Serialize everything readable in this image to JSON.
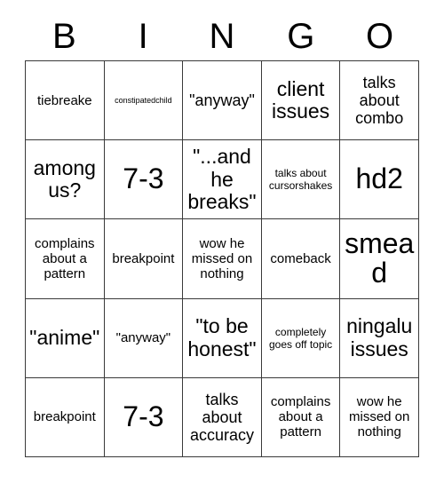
{
  "card": {
    "title": "BINGO",
    "header_letters": [
      "B",
      "I",
      "N",
      "G",
      "O"
    ],
    "columns": 5,
    "rows": 5,
    "colors": {
      "background": "#ffffff",
      "text": "#000000",
      "grid_line": "#3a3a3a"
    },
    "cells": [
      {
        "text": "tiebreake",
        "size": "fs-md"
      },
      {
        "text": "constipatedchild",
        "size": "fs-xs"
      },
      {
        "text": "\"anyway\"",
        "size": "fs-lg"
      },
      {
        "text": "client issues",
        "size": "fs-xl"
      },
      {
        "text": "talks about combo",
        "size": "fs-lg"
      },
      {
        "text": "among us?",
        "size": "fs-xl"
      },
      {
        "text": "7-3",
        "size": "fs-xxl"
      },
      {
        "text": "\"...and he breaks\"",
        "size": "fs-xl"
      },
      {
        "text": "talks about cursorshakes",
        "size": "fs-sm"
      },
      {
        "text": "hd2",
        "size": "fs-xxl"
      },
      {
        "text": "complains about a pattern",
        "size": "fs-md"
      },
      {
        "text": "breakpoint",
        "size": "fs-md"
      },
      {
        "text": "wow he missed on nothing",
        "size": "fs-md"
      },
      {
        "text": "comeback",
        "size": "fs-md"
      },
      {
        "text": "smead",
        "size": "fs-xxl"
      },
      {
        "text": "\"anime\"",
        "size": "fs-xl"
      },
      {
        "text": "\"anyway\"",
        "size": "fs-md"
      },
      {
        "text": "\"to be honest\"",
        "size": "fs-xl"
      },
      {
        "text": "completely goes off topic",
        "size": "fs-sm"
      },
      {
        "text": "ningalu issues",
        "size": "fs-xl"
      },
      {
        "text": "breakpoint",
        "size": "fs-md"
      },
      {
        "text": "7-3",
        "size": "fs-xxl"
      },
      {
        "text": "talks about accuracy",
        "size": "fs-lg"
      },
      {
        "text": "complains about a pattern",
        "size": "fs-md"
      },
      {
        "text": "wow he missed on nothing",
        "size": "fs-md"
      }
    ]
  }
}
